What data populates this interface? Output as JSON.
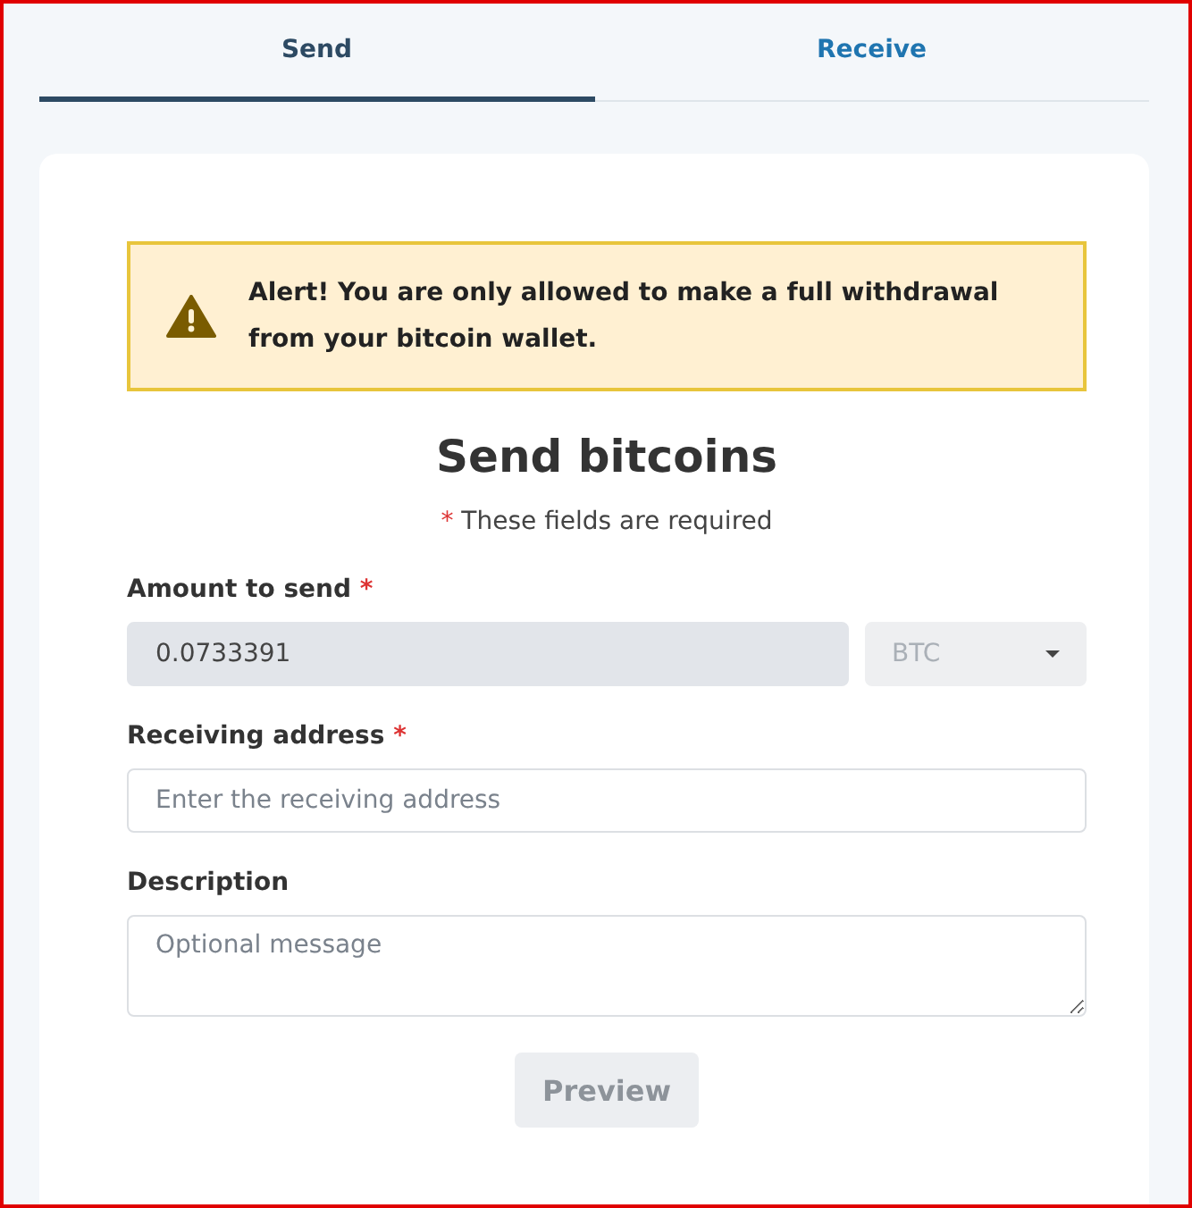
{
  "tabs": [
    {
      "label": "Send",
      "selected": true
    },
    {
      "label": "Receive",
      "selected": false
    }
  ],
  "alert": {
    "text": "Alert! You are only allowed to make a full withdrawal from your bitcoin wallet."
  },
  "title": "Send bitcoins",
  "required_note": {
    "mark": "*",
    "text": "These fields are required"
  },
  "amount": {
    "label": "Amount to send",
    "required_mark": "*",
    "value": "0.0733391",
    "disabled": true,
    "currency": {
      "value": "BTC",
      "disabled": true
    }
  },
  "address": {
    "label": "Receiving address",
    "required_mark": "*",
    "placeholder": "Enter the receiving address"
  },
  "description": {
    "label": "Description",
    "placeholder": "Optional message"
  },
  "preview_button": {
    "label": "Preview",
    "disabled": true
  }
}
